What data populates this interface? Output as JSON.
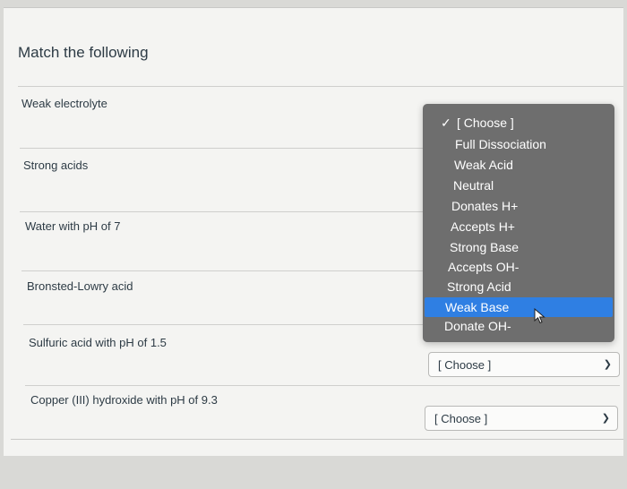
{
  "question": {
    "title": "Match the following"
  },
  "rows": [
    {
      "label": "Weak electrolyte"
    },
    {
      "label": "Strong acids"
    },
    {
      "label": "Water with pH of 7"
    },
    {
      "label": "Bronsted-Lowry acid"
    },
    {
      "label": "Sulfuric acid with pH of 1.5",
      "select_value": "[ Choose ]"
    },
    {
      "label": "Copper (III) hydroxide with pH of 9.3",
      "select_value": "[ Choose ]"
    }
  ],
  "dropdown": {
    "options": [
      {
        "label": "[ Choose ]",
        "checked": true
      },
      {
        "label": "Full Dissociation"
      },
      {
        "label": "Weak Acid"
      },
      {
        "label": "Neutral"
      },
      {
        "label": "Donates H+"
      },
      {
        "label": "Accepts H+"
      },
      {
        "label": "Strong Base"
      },
      {
        "label": "Accepts OH-"
      },
      {
        "label": "Strong Acid"
      },
      {
        "label": "Weak Base",
        "highlighted": true
      },
      {
        "label": "Donate OH-"
      }
    ],
    "check_glyph": "✓"
  },
  "icons": {
    "chevron": "chevron-down-icon",
    "cursor": "mouse-pointer-icon"
  },
  "colors": {
    "highlight": "#2f7fe3",
    "menu_bg": "#6e6e6e"
  }
}
